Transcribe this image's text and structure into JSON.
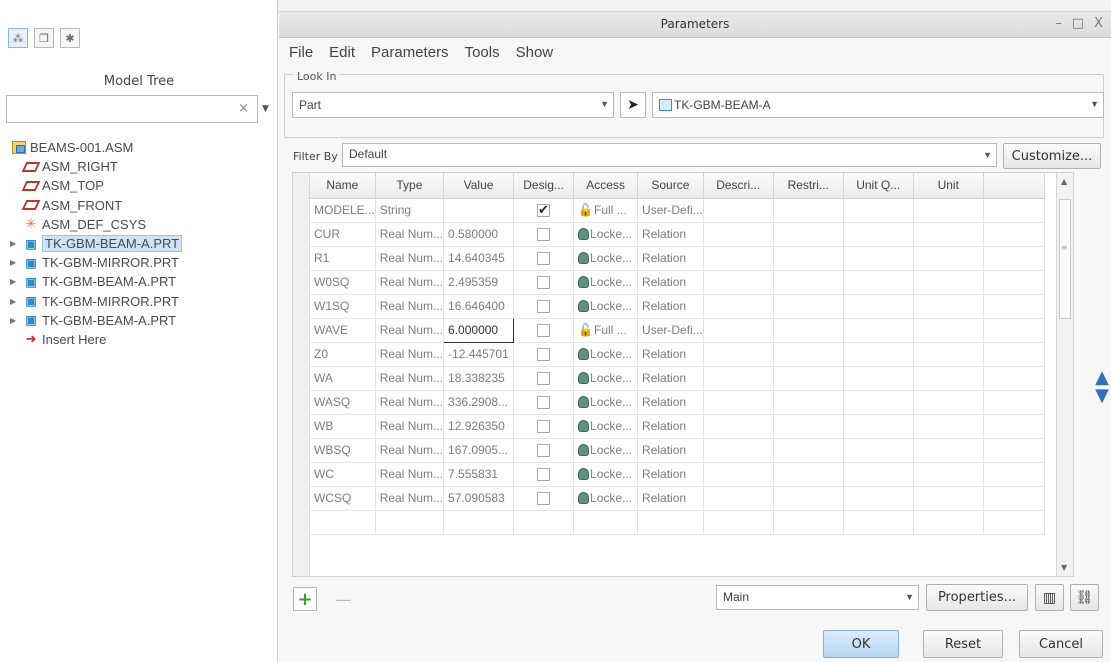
{
  "left_panel": {
    "title": "Model Tree",
    "tabs": [
      "model-tree-icon",
      "layers-icon",
      "favorites-icon"
    ],
    "search_clear": "×",
    "tree": [
      {
        "label": "BEAMS-001.ASM",
        "icon": "assembly-icon",
        "level": 0
      },
      {
        "label": "ASM_RIGHT",
        "icon": "datum-plane-icon",
        "level": 1
      },
      {
        "label": "ASM_TOP",
        "icon": "datum-plane-icon",
        "level": 1
      },
      {
        "label": "ASM_FRONT",
        "icon": "datum-plane-icon",
        "level": 1
      },
      {
        "label": "ASM_DEF_CSYS",
        "icon": "csys-icon",
        "level": 1
      },
      {
        "label": "TK-GBM-BEAM-A.PRT",
        "icon": "part-icon",
        "level": 1,
        "expandable": true,
        "selected": true
      },
      {
        "label": "TK-GBM-MIRROR.PRT",
        "icon": "part-icon",
        "level": 1,
        "expandable": true
      },
      {
        "label": "TK-GBM-BEAM-A.PRT",
        "icon": "part-icon",
        "level": 1,
        "expandable": true
      },
      {
        "label": "TK-GBM-MIRROR.PRT",
        "icon": "part-icon",
        "level": 1,
        "expandable": true
      },
      {
        "label": "TK-GBM-BEAM-A.PRT",
        "icon": "part-icon",
        "level": 1,
        "expandable": true
      },
      {
        "label": "Insert Here",
        "icon": "insert-arrow-icon",
        "level": 1
      }
    ]
  },
  "dialog": {
    "title": "Parameters",
    "window_controls": [
      "–",
      "□",
      "X"
    ],
    "menu": [
      "File",
      "Edit",
      "Parameters",
      "Tools",
      "Show"
    ],
    "look_in": {
      "label": "Look In",
      "type_value": "Part",
      "object_value": "TK-GBM-BEAM-A"
    },
    "filter": {
      "label": "Filter By",
      "value": "Default",
      "customize_label": "Customize..."
    },
    "table": {
      "columns": [
        "Name",
        "Type",
        "Value",
        "Desig...",
        "Access",
        "Source",
        "Descri...",
        "Restri...",
        "Unit Q...",
        "Unit"
      ],
      "rows": [
        {
          "name": "MODELE...",
          "type": "String",
          "value": "",
          "designated": true,
          "access": "Full",
          "access_suffix": "...",
          "access_kind": "full",
          "source": "User-Defi..."
        },
        {
          "name": "CUR",
          "type": "Real Num...",
          "value": "0.580000",
          "designated": false,
          "access": "Locke...",
          "access_suffix": "",
          "access_kind": "locked",
          "source": "Relation"
        },
        {
          "name": "R1",
          "type": "Real Num...",
          "value": "14.640345",
          "designated": false,
          "access": "Locke...",
          "access_suffix": "",
          "access_kind": "locked",
          "source": "Relation"
        },
        {
          "name": "W0SQ",
          "type": "Real Num...",
          "value": "2.495359",
          "designated": false,
          "access": "Locke...",
          "access_suffix": "",
          "access_kind": "locked",
          "source": "Relation"
        },
        {
          "name": "W1SQ",
          "type": "Real Num...",
          "value": "16.646400",
          "designated": false,
          "access": "Locke...",
          "access_suffix": "",
          "access_kind": "locked",
          "source": "Relation"
        },
        {
          "name": "WAVE",
          "type": "Real Num...",
          "value": "6.000000",
          "designated": false,
          "access": "Full",
          "access_suffix": "...",
          "access_kind": "full",
          "source": "User-Defi...",
          "editing": true
        },
        {
          "name": "Z0",
          "type": "Real Num...",
          "value": "-12.445701",
          "designated": false,
          "access": "Locke...",
          "access_suffix": "",
          "access_kind": "locked",
          "source": "Relation"
        },
        {
          "name": "WA",
          "type": "Real Num...",
          "value": "18.338235",
          "designated": false,
          "access": "Locke...",
          "access_suffix": "",
          "access_kind": "locked",
          "source": "Relation"
        },
        {
          "name": "WASQ",
          "type": "Real Num...",
          "value": "336.2908...",
          "designated": false,
          "access": "Locke...",
          "access_suffix": "",
          "access_kind": "locked",
          "source": "Relation"
        },
        {
          "name": "WB",
          "type": "Real Num...",
          "value": "12.926350",
          "designated": false,
          "access": "Locke...",
          "access_suffix": "",
          "access_kind": "locked",
          "source": "Relation"
        },
        {
          "name": "WBSQ",
          "type": "Real Num...",
          "value": "167.0905...",
          "designated": false,
          "access": "Locke...",
          "access_suffix": "",
          "access_kind": "locked",
          "source": "Relation"
        },
        {
          "name": "WC",
          "type": "Real Num...",
          "value": "7.555831",
          "designated": false,
          "access": "Locke...",
          "access_suffix": "",
          "access_kind": "locked",
          "source": "Relation"
        },
        {
          "name": "WCSQ",
          "type": "Real Num...",
          "value": "57.090583",
          "designated": false,
          "access": "Locke...",
          "access_suffix": "",
          "access_kind": "locked",
          "source": "Relation"
        }
      ]
    },
    "bottom": {
      "add": "+",
      "remove": "—",
      "scope_value": "Main",
      "properties_label": "Properties...",
      "table_icon": "column-chooser-icon",
      "find_icon": "binoculars-icon"
    },
    "footer": {
      "ok": "OK",
      "reset": "Reset",
      "cancel": "Cancel"
    }
  }
}
